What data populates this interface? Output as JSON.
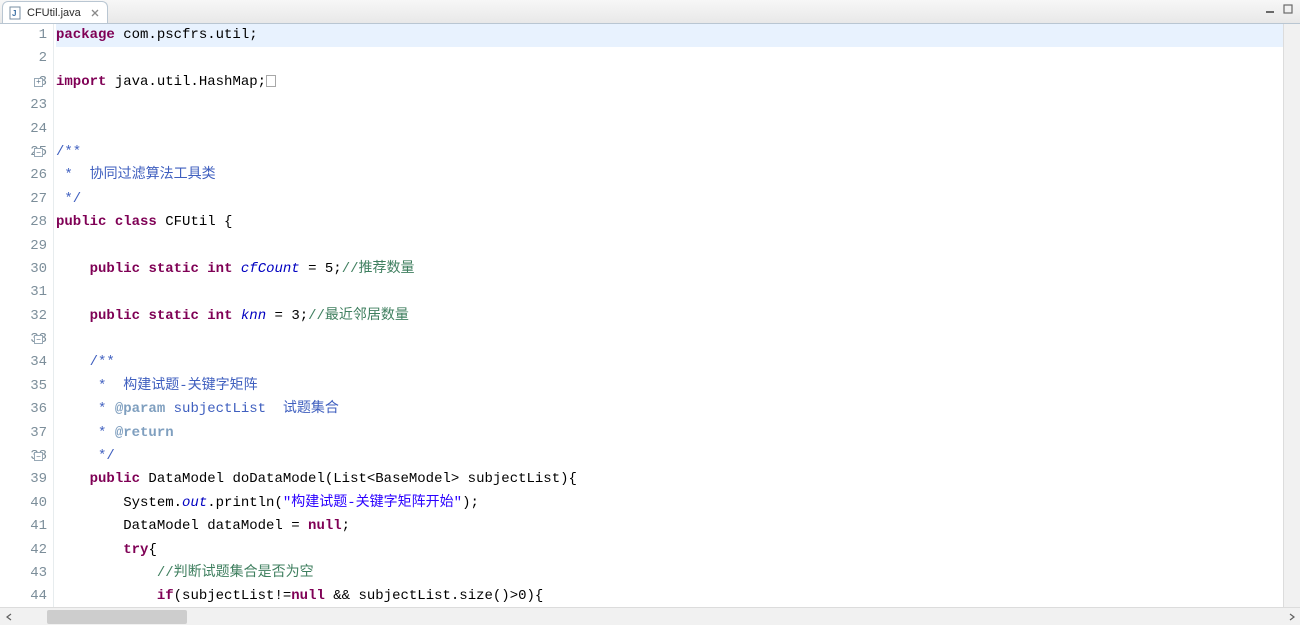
{
  "tab": {
    "filename": "CFUtil.java"
  },
  "gutter": {
    "numbers": [
      "1",
      "2",
      "3",
      "23",
      "24",
      "25",
      "26",
      "27",
      "28",
      "29",
      "30",
      "31",
      "32",
      "33",
      "34",
      "35",
      "36",
      "37",
      "38",
      "39",
      "40",
      "41",
      "42",
      "43",
      "44"
    ],
    "fold": {
      "import_idx": 2,
      "import_marker": "+",
      "collapsible_idx": [
        5,
        13,
        18
      ],
      "collapsible_marker": "−"
    }
  },
  "code": {
    "lines": [
      {
        "row": 0,
        "hl": true,
        "seg": [
          [
            "kw",
            "package"
          ],
          [
            "plain",
            " com.pscfrs.util;"
          ]
        ]
      },
      {
        "row": 1,
        "seg": []
      },
      {
        "row": 2,
        "seg": [
          [
            "kw",
            "import"
          ],
          [
            "plain",
            " java.util.HashMap;"
          ],
          [
            "foldbox",
            ""
          ]
        ]
      },
      {
        "row": 3,
        "seg": []
      },
      {
        "row": 4,
        "seg": []
      },
      {
        "row": 5,
        "seg": [
          [
            "jd",
            "/**"
          ]
        ]
      },
      {
        "row": 6,
        "seg": [
          [
            "jd",
            " *  协同过滤算法工具类"
          ]
        ]
      },
      {
        "row": 7,
        "seg": [
          [
            "jd",
            " */"
          ]
        ]
      },
      {
        "row": 8,
        "seg": [
          [
            "kw",
            "public"
          ],
          [
            "plain",
            " "
          ],
          [
            "kw",
            "class"
          ],
          [
            "plain",
            " CFUtil {"
          ]
        ]
      },
      {
        "row": 9,
        "seg": []
      },
      {
        "row": 10,
        "seg": [
          [
            "plain",
            "    "
          ],
          [
            "kw",
            "public"
          ],
          [
            "plain",
            " "
          ],
          [
            "kw",
            "static"
          ],
          [
            "plain",
            " "
          ],
          [
            "kw",
            "int"
          ],
          [
            "plain",
            " "
          ],
          [
            "field",
            "cfCount"
          ],
          [
            "plain",
            " = 5;"
          ],
          [
            "cm",
            "//推荐数量"
          ]
        ]
      },
      {
        "row": 11,
        "seg": []
      },
      {
        "row": 12,
        "seg": [
          [
            "plain",
            "    "
          ],
          [
            "kw",
            "public"
          ],
          [
            "plain",
            " "
          ],
          [
            "kw",
            "static"
          ],
          [
            "plain",
            " "
          ],
          [
            "kw",
            "int"
          ],
          [
            "plain",
            " "
          ],
          [
            "field",
            "knn"
          ],
          [
            "plain",
            " = 3;"
          ],
          [
            "cm",
            "//最近邻居数量"
          ]
        ]
      },
      {
        "row": 13,
        "seg": []
      },
      {
        "row": 14,
        "seg": [
          [
            "plain",
            "    "
          ],
          [
            "jd",
            "/**"
          ]
        ]
      },
      {
        "row": 15,
        "seg": [
          [
            "jd",
            "     *  构建试题-关键字矩阵"
          ]
        ]
      },
      {
        "row": 16,
        "seg": [
          [
            "jd",
            "     * "
          ],
          [
            "jdtag",
            "@param"
          ],
          [
            "jd",
            " subjectList  试题集合"
          ]
        ]
      },
      {
        "row": 17,
        "seg": [
          [
            "jd",
            "     * "
          ],
          [
            "jdtag",
            "@return"
          ]
        ]
      },
      {
        "row": 18,
        "seg": [
          [
            "jd",
            "     */"
          ]
        ]
      },
      {
        "row": 19,
        "seg": [
          [
            "plain",
            "    "
          ],
          [
            "kw",
            "public"
          ],
          [
            "plain",
            " DataModel doDataModel(List<BaseModel> subjectList){"
          ]
        ]
      },
      {
        "row": 20,
        "seg": [
          [
            "plain",
            "        System."
          ],
          [
            "field",
            "out"
          ],
          [
            "plain",
            ".println("
          ],
          [
            "str",
            "\"构建试题-关键字矩阵开始\""
          ],
          [
            "plain",
            ");"
          ]
        ]
      },
      {
        "row": 21,
        "seg": [
          [
            "plain",
            "        DataModel dataModel = "
          ],
          [
            "kw",
            "null"
          ],
          [
            "plain",
            ";"
          ]
        ]
      },
      {
        "row": 22,
        "seg": [
          [
            "plain",
            "        "
          ],
          [
            "kw",
            "try"
          ],
          [
            "plain",
            "{"
          ]
        ]
      },
      {
        "row": 23,
        "seg": [
          [
            "plain",
            "            "
          ],
          [
            "cm",
            "//判断试题集合是否为空"
          ]
        ]
      },
      {
        "row": 24,
        "seg": [
          [
            "plain",
            "            "
          ],
          [
            "kw",
            "if"
          ],
          [
            "plain",
            "(subjectList!="
          ],
          [
            "kw",
            "null"
          ],
          [
            "plain",
            " && subjectList.size()>0){"
          ]
        ]
      }
    ]
  }
}
